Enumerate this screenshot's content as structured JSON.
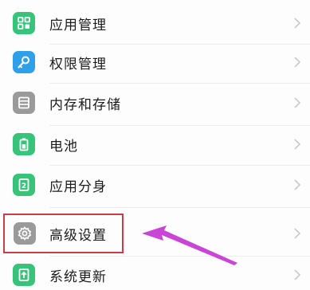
{
  "settings": {
    "items": [
      {
        "label": "应用管理",
        "icon": "app-grid-icon"
      },
      {
        "label": "权限管理",
        "icon": "key-icon"
      },
      {
        "label": "内存和存储",
        "icon": "storage-list-icon"
      },
      {
        "label": "电池",
        "icon": "battery-icon"
      },
      {
        "label": "应用分身",
        "icon": "app-clone-icon"
      },
      {
        "label": "高级设置",
        "icon": "gear-icon"
      },
      {
        "label": "系统更新",
        "icon": "system-update-icon"
      }
    ]
  },
  "colors": {
    "green": "#37c37a",
    "blue": "#2fa0e8",
    "gray": "#9a9a9a",
    "highlight": "#cf3a4a",
    "arrow": "#c845d6"
  }
}
